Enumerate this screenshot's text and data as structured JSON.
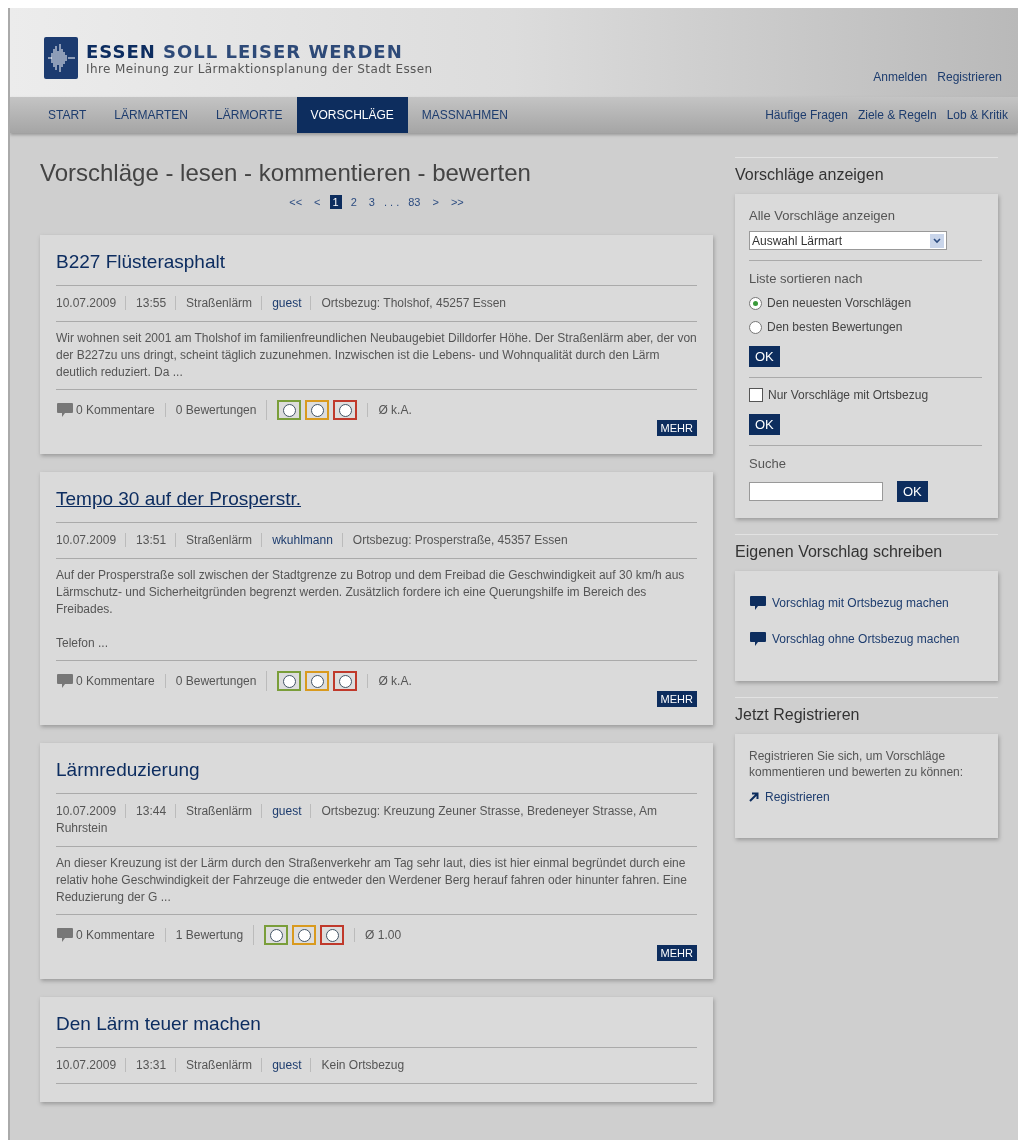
{
  "header": {
    "title_accent": "ESSEN",
    "title": "SOLL LEISER WERDEN",
    "subtitle": "Ihre Meinung zur Lärmaktionsplanung der Stadt Essen",
    "account_links": [
      "Anmelden",
      "Registrieren"
    ]
  },
  "nav": {
    "tabs": [
      {
        "label": "START",
        "selected": false
      },
      {
        "label": "LÄRMARTEN",
        "selected": false
      },
      {
        "label": "LÄRMORTE",
        "selected": false
      },
      {
        "label": "VORSCHLÄGE",
        "selected": true
      },
      {
        "label": "MASSNAHMEN",
        "selected": false
      }
    ],
    "links": [
      "Häufige Fragen",
      "Ziele & Regeln",
      "Lob & Kritik"
    ]
  },
  "main": {
    "heading": "Vorschläge - lesen - kommentieren - bewerten",
    "pagination": [
      {
        "label": "<<",
        "selected": false
      },
      {
        "label": "<",
        "selected": false
      },
      {
        "label": "1",
        "selected": true
      },
      {
        "label": "2",
        "selected": false
      },
      {
        "label": "3",
        "selected": false
      },
      {
        "label": ". . .",
        "kind": "gap"
      },
      {
        "label": "83",
        "selected": false
      },
      {
        "label": ">",
        "selected": false
      },
      {
        "label": ">>",
        "selected": false
      }
    ],
    "proposals": [
      {
        "title": "B227 Flüsterasphalt",
        "hovered": false,
        "date": "10.07.2009",
        "time": "13:55",
        "category": "Straßenlärm",
        "author": "guest",
        "location": "Ortsbezug: Tholshof, 45257 Essen",
        "paragraphs": [
          "Wir wohnen seit 2001 am Tholshof im familienfreundlichen Neubaugebiet Dilldorfer Höhe. Der Straßenlärm aber, der von der B227zu uns dringt, scheint täglich zuzunehmen. Inzwischen ist die Lebens- und Wohnqualität durch den Lärm deutlich reduziert. Da ..."
        ],
        "comments": "0 Kommentare",
        "ratings": "0 Bewertungen",
        "rating_buttons": [
          {
            "color": "#7a9e3a"
          },
          {
            "color": "#d99a1e"
          },
          {
            "color": "#c0392b"
          }
        ],
        "average": "Ø k.A.",
        "more": "MEHR"
      },
      {
        "title": "Tempo 30 auf der Prosperstr.",
        "hovered": true,
        "date": "10.07.2009",
        "time": "13:51",
        "category": "Straßenlärm",
        "author": "wkuhlmann",
        "location": "Ortsbezug: Prosperstraße, 45357 Essen",
        "paragraphs": [
          "Auf der Prosperstraße soll zwischen der Stadtgrenze zu Botrop und dem Freibad die Geschwindigkeit auf 30 km/h aus Lärmschutz- und Sicherheitgründen begrenzt werden. Zusätzlich fordere ich eine Querungshilfe im Bereich des Freibades.",
          "Telefon ..."
        ],
        "comments": "0 Kommentare",
        "ratings": "0 Bewertungen",
        "rating_buttons": [
          {
            "color": "#7a9e3a"
          },
          {
            "color": "#d99a1e"
          },
          {
            "color": "#c0392b"
          }
        ],
        "average": "Ø k.A.",
        "more": "MEHR"
      },
      {
        "title": "Lärmreduzierung",
        "hovered": false,
        "date": "10.07.2009",
        "time": "13:44",
        "category": "Straßenlärm",
        "author": "guest",
        "location": "Ortsbezug: Kreuzung Zeuner Strasse, Bredeneyer Strasse, Am Ruhrstein",
        "paragraphs": [
          "An dieser Kreuzung ist der Lärm durch den Straßenverkehr am Tag sehr laut, dies ist hier einmal begründet durch eine relativ hohe Geschwindigkeit der Fahrzeuge die entweder den Werdener Berg herauf fahren oder hinunter fahren. Eine Reduzierung der G ..."
        ],
        "comments": "0 Kommentare",
        "ratings": "1 Bewertung",
        "rating_buttons": [
          {
            "color": "#7a9e3a"
          },
          {
            "color": "#d99a1e"
          },
          {
            "color": "#c0392b"
          }
        ],
        "average": "Ø 1.00",
        "more": "MEHR"
      },
      {
        "title": "Den Lärm teuer machen",
        "hovered": false,
        "date": "10.07.2009",
        "time": "13:31",
        "category": "Straßenlärm",
        "author": "guest",
        "location": "Kein Ortsbezug"
      }
    ]
  },
  "sidebar": {
    "filter": {
      "heading": "Vorschläge anzeigen",
      "all_label": "Alle Vorschläge anzeigen",
      "select_value": "Auswahl Lärmart",
      "sort_label": "Liste sortieren nach",
      "sort_options": [
        {
          "label": "Den neuesten Vorschlägen",
          "selected": true
        },
        {
          "label": "Den besten Bewertungen",
          "selected": false
        }
      ],
      "ok1": "OK",
      "location_only": {
        "label": "Nur Vorschläge mit Ortsbezug",
        "checked": false
      },
      "ok2": "OK",
      "search_label": "Suche",
      "ok3": "OK"
    },
    "write": {
      "heading": "Eigenen Vorschlag schreiben",
      "links": [
        "Vorschlag mit Ortsbezug machen",
        "Vorschlag ohne Ortsbezug machen"
      ]
    },
    "register": {
      "heading": "Jetzt Registrieren",
      "text": "Registrieren Sie sich, um Vorschläge kommentieren und bewerten zu können:",
      "link": "Registrieren"
    }
  }
}
